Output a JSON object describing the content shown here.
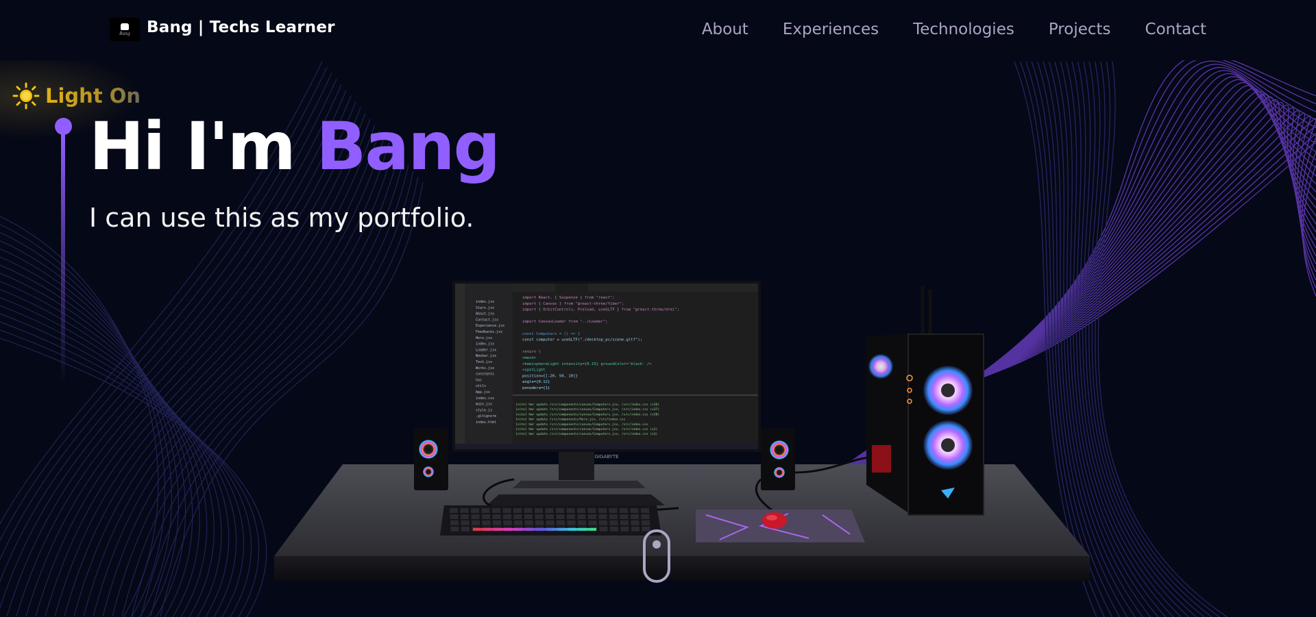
{
  "nav": {
    "brand": "Bang | Techs Learner",
    "logo_icon": "bang-logo-icon",
    "links": [
      "About",
      "Experiences",
      "Technologies",
      "Projects",
      "Contact"
    ]
  },
  "theme_toggle": {
    "label": "Light On",
    "icon": "sun-icon"
  },
  "hero": {
    "greeting": "Hi I'm ",
    "name": "Bang",
    "subtitle": "I can use this as my portfolio."
  },
  "scene": {
    "monitor_brand": "GIGABYTE",
    "code_lines": [
      "import React, { Suspense } from \"react\";",
      "import { Canvas } from \"@react-three/fiber\";",
      "import { OrbitControls, Preload, useGLTF } from \"@react-three/drei\";",
      "",
      "import CanvasLoader from \"../Loader\";",
      "",
      "const Computers = () => {",
      "  const computer = useGLTF(\"./desktop_pc/scene.gltf\");",
      "",
      "  return (",
      "    <mesh>",
      "      <hemisphereLight intensity={0.15} groundColor='black' />",
      "      <spotLight",
      "        position={[-20, 50, 10]}",
      "        angle={0.12}",
      "        penumbra={1}"
    ],
    "terminal_lines": [
      "[vite] hmr update /src/components/canvas/Computers.jsx, /src/index.css (x36)",
      "[vite] hmr update /src/components/canvas/Computers.jsx, /src/index.css (x37)",
      "[vite] hmr update /src/components/canvas/Computers.jsx, /src/index.css (x38)",
      "[vite] hmr update /src/components/Hero.jsx, /src/index.css",
      "[vite] hmr update /src/components/canvas/Computers.jsx, /src/index.css",
      "[vite] hmr update /src/components/canvas/Computers.jsx, /src/index.css (x2)",
      "[vite] hmr update /src/components/canvas/Computers.jsx, /src/index.css (x3)"
    ],
    "file_tree": [
      "index.jsx",
      "Stars.jsx",
      "About.jsx",
      "Contact.jsx",
      "Experience.jsx",
      "Feedbacks.jsx",
      "Hero.jsx",
      "index.jsx",
      "Loader.jsx",
      "Navbar.jsx",
      "Tech.jsx",
      "Works.jsx",
      "constants",
      "hoc",
      "utils",
      "App.jsx",
      "index.css",
      "main.jsx",
      "style.js",
      ".gitignore",
      "index.html"
    ]
  },
  "scroll_indicator": {
    "icon": "scroll-mouse-icon"
  },
  "colors": {
    "background": "#050816",
    "accent": "#915eff",
    "nav_text": "#aaa6c3",
    "sun": "#f4c20d"
  }
}
